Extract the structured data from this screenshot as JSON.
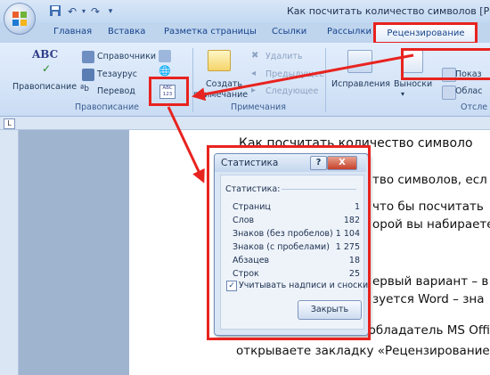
{
  "window": {
    "title": "Как посчитать количество символов [Ре"
  },
  "ribbon_tabs": [
    "Главная",
    "Вставка",
    "Разметка страницы",
    "Ссылки",
    "Рассылки",
    "Рецензирование"
  ],
  "ribbon": {
    "proofing": {
      "spelling_icon_text": "ABC",
      "spelling": "Правописание",
      "reference": "Справочники",
      "thesaurus": "Тезаурус",
      "translate": "Перевод",
      "wordcount_icon_text_top": "ABC",
      "wordcount_icon_text_bottom": "123",
      "group_label": "Правописание"
    },
    "comments": {
      "create_line1": "Создать",
      "create_line2": "примечание",
      "delete": "Удалить",
      "previous": "Предыдущее",
      "next": "Следующее",
      "group_label": "Примечания"
    },
    "tracking": {
      "corrections": "Исправления",
      "balloons": "Выноски",
      "show": "Показ",
      "area": "Облас",
      "group_label": "Отсле"
    }
  },
  "ruler": {
    "tab_selector": "L"
  },
  "document": {
    "lines": [
      "Как посчитать количество символо",
      "тво символов, есл",
      "что бы посчитать",
      "орой вы набираете",
      "ервый вариант – в",
      "зуется Word – зна",
      "Если вы счастливый обладатель MS Offic",
      "открываете закладку «Рецензирование»"
    ]
  },
  "dialog": {
    "title": "Статистика",
    "help_label": "?",
    "close_label": "X",
    "heading": "Статистика:",
    "stats": [
      {
        "label": "Страниц",
        "value": "1"
      },
      {
        "label": "Слов",
        "value": "182"
      },
      {
        "label": "Знаков (без пробелов)",
        "value": "1 104"
      },
      {
        "label": "Знаков (с пробелами)",
        "value": "1 275"
      },
      {
        "label": "Абзацев",
        "value": "18"
      },
      {
        "label": "Строк",
        "value": "25"
      }
    ],
    "checkbox_label": "Учитывать надписи и сноски",
    "checkbox_checked": true,
    "checkbox_mark": "✓",
    "close_button": "Закрыть"
  },
  "colors": {
    "highlight": "#e8231f",
    "ribbon_text": "#15428b"
  }
}
